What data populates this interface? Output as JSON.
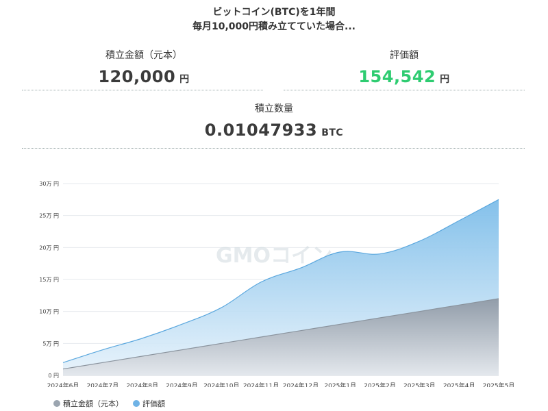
{
  "header": {
    "line1": "ビットコイン(BTC)を1年間",
    "line2": "毎月10,000円積み立てていた場合..."
  },
  "stats": {
    "principal": {
      "label": "積立金額（元本）",
      "value": "120,000",
      "unit": "円"
    },
    "valuation": {
      "label": "評価額",
      "value": "154,542",
      "unit": "円",
      "color": "#2ecc71"
    },
    "quantity": {
      "label": "積立数量",
      "value": "0.01047933",
      "unit": "BTC"
    }
  },
  "watermark": "GMOコイン",
  "chart_data": {
    "type": "area",
    "categories": [
      "2024年6月",
      "2024年7月",
      "2024年8月",
      "2024年9月",
      "2024年10月",
      "2024年11月",
      "2024年12月",
      "2025年1月",
      "2025年2月",
      "2025年3月",
      "2025年4月",
      "2025年5月"
    ],
    "y_ticks": [
      "0 円",
      "5万 円",
      "10万 円",
      "15万 円",
      "20万 円",
      "25万 円",
      "30万 円"
    ],
    "ylim": [
      0,
      300000
    ],
    "grid": true,
    "legend_position": "bottom-left",
    "series": [
      {
        "name": "積立金額（元本）",
        "color": "#9ba5b0",
        "values": [
          10000,
          20000,
          30000,
          40000,
          50000,
          60000,
          70000,
          80000,
          90000,
          100000,
          110000,
          120000
        ]
      },
      {
        "name": "評価額",
        "color": "#6fb3e6",
        "values": [
          20000,
          40000,
          58000,
          80000,
          106000,
          146000,
          168000,
          193000,
          190000,
          210000,
          242000,
          275000
        ]
      }
    ]
  }
}
